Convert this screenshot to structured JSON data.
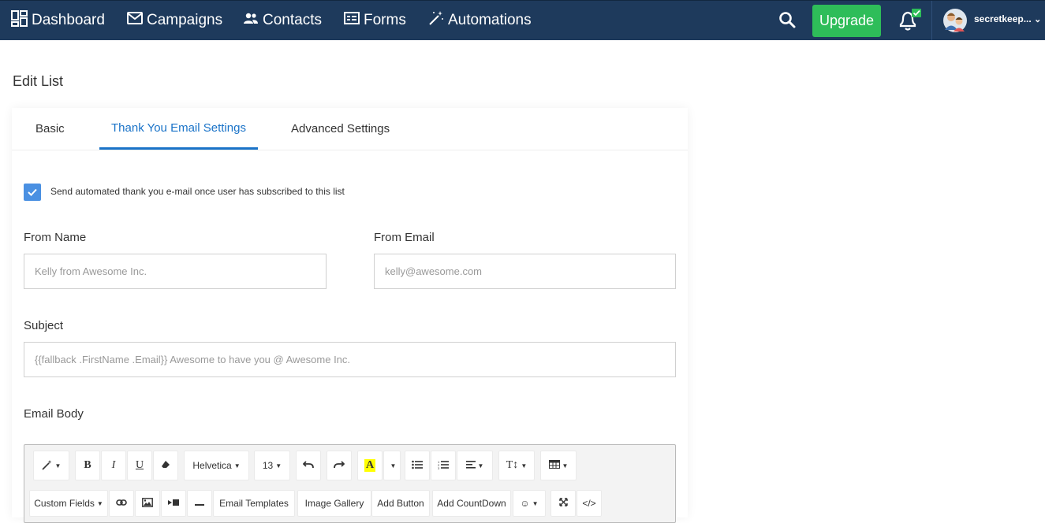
{
  "nav": {
    "dashboard": "Dashboard",
    "campaigns": "Campaigns",
    "contacts": "Contacts",
    "forms": "Forms",
    "automations": "Automations",
    "upgrade": "Upgrade",
    "username": "secretkeep...",
    "icons": [
      "dashboard-icon",
      "envelope-icon",
      "people-icon",
      "form-icon",
      "magic-wand-icon",
      "search-icon",
      "bell-icon",
      "avatar-icon",
      "chevron-down-icon"
    ]
  },
  "page": {
    "title": "Edit List"
  },
  "tabs": [
    {
      "label": "Basic"
    },
    {
      "label": "Thank You Email Settings"
    },
    {
      "label": "Advanced Settings"
    }
  ],
  "thank_you": {
    "checkbox_label": "Send automated thank you e-mail once user has subscribed to this list",
    "checked": true,
    "from_name_label": "From Name",
    "from_name_placeholder": "Kelly from Awesome Inc.",
    "from_email_label": "From Email",
    "from_email_placeholder": "kelly@awesome.com",
    "subject_label": "Subject",
    "subject_placeholder": "{{fallback .FirstName .Email}} Awesome to have you @ Awesome Inc.",
    "body_label": "Email Body"
  },
  "toolbar": {
    "font": "Helvetica",
    "size": "13",
    "custom_fields": "Custom Fields",
    "email_templates": "Email Templates",
    "image_gallery": "Image Gallery",
    "add_button": "Add Button",
    "add_countdown": "Add CountDown",
    "code": "</>"
  },
  "colors": {
    "nav_bg": "#1e3a5c",
    "upgrade": "#2ebd59",
    "accent": "#1a73c8",
    "checkbox": "#4a90e2"
  }
}
